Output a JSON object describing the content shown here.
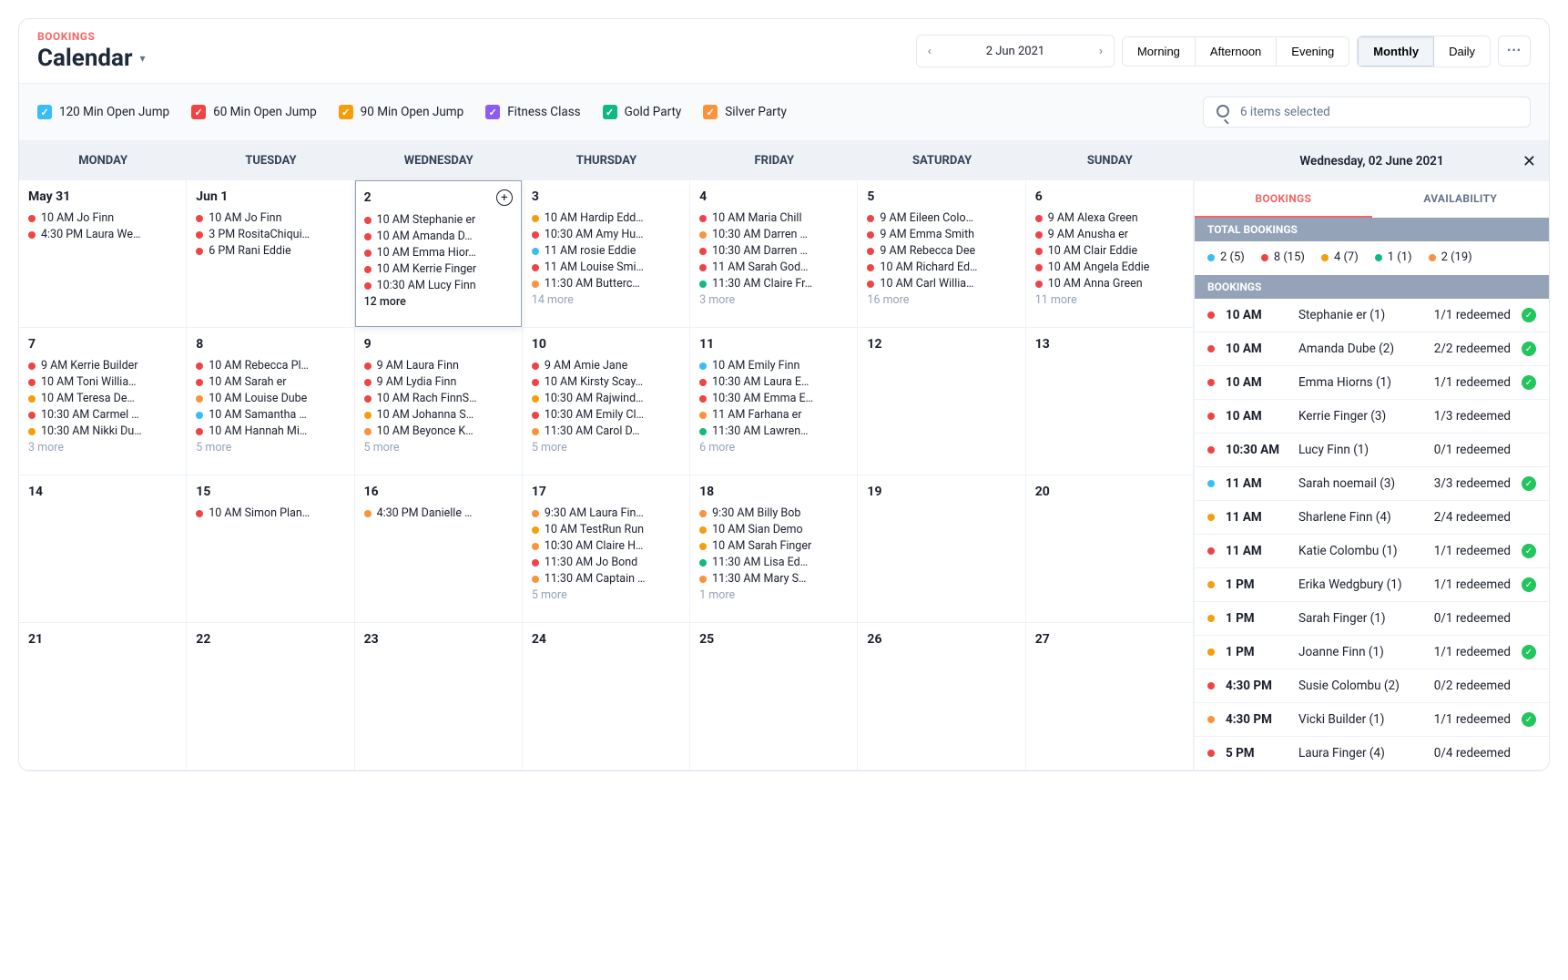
{
  "breadcrumb": "BOOKINGS",
  "pageTitle": "Calendar",
  "dateDisplay": "2 Jun 2021",
  "timeOfDay": [
    "Morning",
    "Afternoon",
    "Evening"
  ],
  "viewModes": [
    "Monthly",
    "Daily"
  ],
  "activeViewMode": "Monthly",
  "moreMenu": "···",
  "legends": [
    {
      "label": "120 Min Open Jump",
      "color": "#38bdf8"
    },
    {
      "label": "60 Min Open Jump",
      "color": "#ef4444"
    },
    {
      "label": "90 Min Open Jump",
      "color": "#f59e0b"
    },
    {
      "label": "Fitness Class",
      "color": "#8b5cf6"
    },
    {
      "label": "Gold Party",
      "color": "#10b981"
    },
    {
      "label": "Silver Party",
      "color": "#fb923c"
    }
  ],
  "searchPlaceholder": "6 items selected",
  "weekdays": [
    "MONDAY",
    "TUESDAY",
    "WEDNESDAY",
    "THURSDAY",
    "FRIDAY",
    "SATURDAY",
    "SUNDAY"
  ],
  "cells": [
    {
      "date": "May 31",
      "events": [
        {
          "c": "#ef4444",
          "t": "10 AM Jo Finn"
        },
        {
          "c": "#ef4444",
          "t": "4:30 PM Laura We…"
        }
      ]
    },
    {
      "date": "Jun 1",
      "events": [
        {
          "c": "#ef4444",
          "t": "10 AM Jo Finn"
        },
        {
          "c": "#ef4444",
          "t": "3 PM RositaChiqui…"
        },
        {
          "c": "#ef4444",
          "t": "6 PM Rani Eddie"
        }
      ]
    },
    {
      "date": "2",
      "selected": true,
      "plus": true,
      "events": [
        {
          "c": "#ef4444",
          "t": "10 AM Stephanie er"
        },
        {
          "c": "#ef4444",
          "t": "10 AM Amanda D…"
        },
        {
          "c": "#ef4444",
          "t": "10 AM Emma Hior…"
        },
        {
          "c": "#ef4444",
          "t": "10 AM Kerrie Finger"
        },
        {
          "c": "#ef4444",
          "t": "10:30 AM Lucy Finn"
        }
      ],
      "moreText": "12 more",
      "moreDark": true
    },
    {
      "date": "3",
      "events": [
        {
          "c": "#f59e0b",
          "t": "10 AM Hardip Edd…"
        },
        {
          "c": "#ef4444",
          "t": "10:30 AM Amy Hu…"
        },
        {
          "c": "#38bdf8",
          "t": "11 AM rosie Eddie"
        },
        {
          "c": "#ef4444",
          "t": "11 AM Louise Smi…"
        },
        {
          "c": "#fb923c",
          "t": "11:30 AM Butterc…"
        }
      ],
      "moreText": "14 more"
    },
    {
      "date": "4",
      "events": [
        {
          "c": "#ef4444",
          "t": "10 AM Maria Chill"
        },
        {
          "c": "#fb923c",
          "t": "10:30 AM Darren …"
        },
        {
          "c": "#ef4444",
          "t": "10:30 AM Darren …"
        },
        {
          "c": "#ef4444",
          "t": "11 AM Sarah God…"
        },
        {
          "c": "#10b981",
          "t": "11:30 AM Claire Fr…"
        }
      ],
      "moreText": "3 more"
    },
    {
      "date": "5",
      "events": [
        {
          "c": "#ef4444",
          "t": "9 AM Eileen Colo…"
        },
        {
          "c": "#ef4444",
          "t": "9 AM Emma Smith"
        },
        {
          "c": "#ef4444",
          "t": "9 AM Rebecca Dee"
        },
        {
          "c": "#ef4444",
          "t": "10 AM Richard Ed…"
        },
        {
          "c": "#ef4444",
          "t": "10 AM Carl Willia…"
        }
      ],
      "moreText": "16 more"
    },
    {
      "date": "6",
      "events": [
        {
          "c": "#ef4444",
          "t": "9 AM Alexa Green"
        },
        {
          "c": "#ef4444",
          "t": "9 AM Anusha er"
        },
        {
          "c": "#ef4444",
          "t": "10 AM Clair Eddie"
        },
        {
          "c": "#ef4444",
          "t": "10 AM Angela Eddie"
        },
        {
          "c": "#ef4444",
          "t": "10 AM Anna Green"
        }
      ],
      "moreText": "11 more"
    },
    {
      "date": "7",
      "events": [
        {
          "c": "#ef4444",
          "t": "9 AM Kerrie Builder"
        },
        {
          "c": "#ef4444",
          "t": "10 AM Toni Willia…"
        },
        {
          "c": "#f59e0b",
          "t": "10 AM Teresa De…"
        },
        {
          "c": "#ef4444",
          "t": "10:30 AM Carmel …"
        },
        {
          "c": "#f59e0b",
          "t": "10:30 AM Nikki Du…"
        }
      ],
      "moreText": "3 more"
    },
    {
      "date": "8",
      "events": [
        {
          "c": "#ef4444",
          "t": "10 AM Rebecca Pl…"
        },
        {
          "c": "#ef4444",
          "t": "10 AM Sarah er"
        },
        {
          "c": "#fb923c",
          "t": "10 AM Louise Dube"
        },
        {
          "c": "#38bdf8",
          "t": "10 AM Samantha …"
        },
        {
          "c": "#ef4444",
          "t": "10 AM Hannah Mi…"
        }
      ],
      "moreText": "5 more"
    },
    {
      "date": "9",
      "events": [
        {
          "c": "#ef4444",
          "t": "9 AM Laura Finn"
        },
        {
          "c": "#ef4444",
          "t": "9 AM Lydia Finn"
        },
        {
          "c": "#ef4444",
          "t": "10 AM Rach FinnS…"
        },
        {
          "c": "#f59e0b",
          "t": "10 AM Johanna S…"
        },
        {
          "c": "#fb923c",
          "t": "10 AM Beyonce K…"
        }
      ],
      "moreText": "5 more"
    },
    {
      "date": "10",
      "events": [
        {
          "c": "#ef4444",
          "t": "9 AM Amie Jane"
        },
        {
          "c": "#ef4444",
          "t": "10 AM Kirsty Scay…"
        },
        {
          "c": "#f59e0b",
          "t": "10:30 AM Rajwind…"
        },
        {
          "c": "#ef4444",
          "t": "10:30 AM Emily Cl…"
        },
        {
          "c": "#fb923c",
          "t": "11:30 AM Carol D…"
        }
      ],
      "moreText": "5 more"
    },
    {
      "date": "11",
      "events": [
        {
          "c": "#38bdf8",
          "t": "10 AM Emily Finn"
        },
        {
          "c": "#ef4444",
          "t": "10:30 AM Laura E…"
        },
        {
          "c": "#ef4444",
          "t": "10:30 AM Emma E…"
        },
        {
          "c": "#fb923c",
          "t": "11 AM Farhana er"
        },
        {
          "c": "#10b981",
          "t": "11:30 AM Lawren…"
        }
      ],
      "moreText": "6 more"
    },
    {
      "date": "12",
      "events": []
    },
    {
      "date": "13",
      "events": []
    },
    {
      "date": "14",
      "events": []
    },
    {
      "date": "15",
      "events": [
        {
          "c": "#ef4444",
          "t": "10 AM Simon Plan…"
        }
      ]
    },
    {
      "date": "16",
      "events": [
        {
          "c": "#fb923c",
          "t": "4:30 PM Danielle …"
        }
      ]
    },
    {
      "date": "17",
      "events": [
        {
          "c": "#fb923c",
          "t": "9:30 AM Laura Fin…"
        },
        {
          "c": "#f59e0b",
          "t": "10 AM TestRun Run"
        },
        {
          "c": "#fb923c",
          "t": "10:30 AM Claire H…"
        },
        {
          "c": "#ef4444",
          "t": "11:30 AM Jo Bond"
        },
        {
          "c": "#fb923c",
          "t": "11:30 AM Captain …"
        }
      ],
      "moreText": "5 more"
    },
    {
      "date": "18",
      "events": [
        {
          "c": "#fb923c",
          "t": "9:30 AM Billy Bob"
        },
        {
          "c": "#f59e0b",
          "t": "10 AM Sian Demo"
        },
        {
          "c": "#f59e0b",
          "t": "10 AM Sarah Finger"
        },
        {
          "c": "#10b981",
          "t": "11:30 AM Lisa Ed…"
        },
        {
          "c": "#fb923c",
          "t": "11:30 AM Mary S…"
        }
      ],
      "moreText": "1 more"
    },
    {
      "date": "19",
      "events": []
    },
    {
      "date": "20",
      "events": []
    },
    {
      "date": "21",
      "events": []
    },
    {
      "date": "22",
      "events": []
    },
    {
      "date": "23",
      "events": []
    },
    {
      "date": "24",
      "events": []
    },
    {
      "date": "25",
      "events": []
    },
    {
      "date": "26",
      "events": []
    },
    {
      "date": "27",
      "events": []
    }
  ],
  "side": {
    "title": "Wednesday, 02 June 2021",
    "tabs": [
      "BOOKINGS",
      "AVAILABILITY"
    ],
    "activeTab": "BOOKINGS",
    "totalLabel": "TOTAL BOOKINGS",
    "totals": [
      {
        "c": "#38bdf8",
        "t": "2 (5)"
      },
      {
        "c": "#ef4444",
        "t": "8 (15)"
      },
      {
        "c": "#f59e0b",
        "t": "4 (7)"
      },
      {
        "c": "#10b981",
        "t": "1 (1)"
      },
      {
        "c": "#fb923c",
        "t": "2 (19)"
      }
    ],
    "bookingsLabel": "BOOKINGS",
    "rows": [
      {
        "c": "#ef4444",
        "time": "10 AM",
        "name": "Stephanie er (1)",
        "status": "1/1 redeemed",
        "ok": true
      },
      {
        "c": "#ef4444",
        "time": "10 AM",
        "name": "Amanda Dube (2)",
        "status": "2/2 redeemed",
        "ok": true
      },
      {
        "c": "#ef4444",
        "time": "10 AM",
        "name": "Emma Hiorns (1)",
        "status": "1/1 redeemed",
        "ok": true
      },
      {
        "c": "#ef4444",
        "time": "10 AM",
        "name": "Kerrie Finger (3)",
        "status": "1/3 redeemed",
        "ok": false
      },
      {
        "c": "#ef4444",
        "time": "10:30 AM",
        "name": "Lucy Finn (1)",
        "status": "0/1 redeemed",
        "ok": false
      },
      {
        "c": "#38bdf8",
        "time": "11 AM",
        "name": "Sarah noemail (3)",
        "status": "3/3 redeemed",
        "ok": true
      },
      {
        "c": "#f59e0b",
        "time": "11 AM",
        "name": "Sharlene Finn (4)",
        "status": "2/4 redeemed",
        "ok": false
      },
      {
        "c": "#ef4444",
        "time": "11 AM",
        "name": "Katie Colombu (1)",
        "status": "1/1 redeemed",
        "ok": true
      },
      {
        "c": "#f59e0b",
        "time": "1 PM",
        "name": "Erika Wedgbury (1)",
        "status": "1/1 redeemed",
        "ok": true
      },
      {
        "c": "#f59e0b",
        "time": "1 PM",
        "name": "Sarah Finger (1)",
        "status": "0/1 redeemed",
        "ok": false
      },
      {
        "c": "#f59e0b",
        "time": "1 PM",
        "name": "Joanne Finn (1)",
        "status": "1/1 redeemed",
        "ok": true
      },
      {
        "c": "#ef4444",
        "time": "4:30 PM",
        "name": "Susie Colombu (2)",
        "status": "0/2 redeemed",
        "ok": false
      },
      {
        "c": "#fb923c",
        "time": "4:30 PM",
        "name": "Vicki Builder (1)",
        "status": "1/1 redeemed",
        "ok": true
      },
      {
        "c": "#ef4444",
        "time": "5 PM",
        "name": "Laura Finger (4)",
        "status": "0/4 redeemed",
        "ok": false
      }
    ]
  }
}
